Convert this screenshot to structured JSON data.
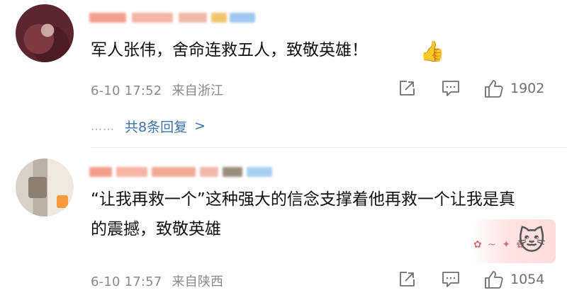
{
  "comments": [
    {
      "text": "军人张伟，舍命连救五人，致敬英雄！",
      "emoji": "thumbs-up",
      "emoji_glyph": "👍",
      "date": "6-10 17:52",
      "location": "来自浙江",
      "likes": "1902",
      "replies_label": "共8条回复",
      "replies_chevron": ">",
      "replies_dots": "……"
    },
    {
      "text": "“让我再救一个”这种强大的信念支撑着他再救一个让我是真的震撼，致敬英雄",
      "sticker": "cat-sticker",
      "sticker_glyph": "🐱",
      "date": "6-10 17:57",
      "location": "来自陕西",
      "likes": "1054"
    }
  ],
  "colors": {
    "link": "#3f6fa8",
    "meta": "#8a8a8a",
    "text": "#111111",
    "icon": "#6f6f6f"
  }
}
